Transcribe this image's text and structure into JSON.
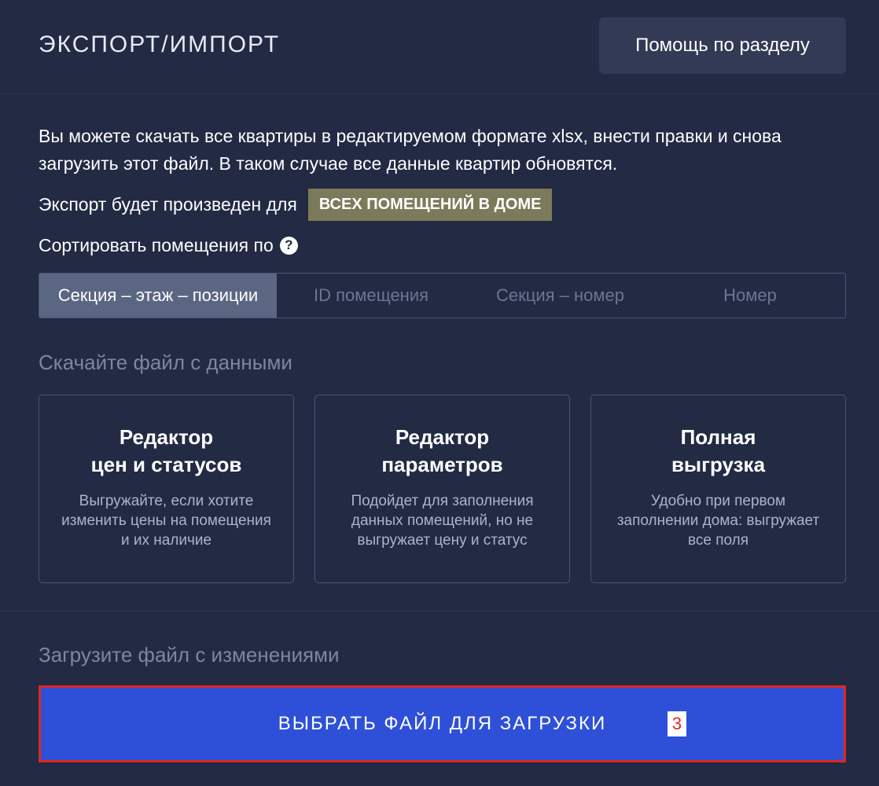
{
  "header": {
    "title": "ЭКСПОРТ/ИМПОРТ",
    "help_button": "Помощь по разделу"
  },
  "intro": {
    "text": "Вы можете скачать все квартиры в редактируемом формате xlsx, внести правки и снова загрузить этот файл. В таком случае все данные квартир обновятся."
  },
  "export_scope": {
    "label": "Экспорт будет произведен для",
    "value": "ВСЕХ ПОМЕЩЕНИЙ В ДОМЕ",
    "color": "#7b7a5a"
  },
  "sort": {
    "label": "Сортировать помещения по",
    "help_icon": "question-circle-icon",
    "help_glyph": "?",
    "options": [
      {
        "label": "Секция – этаж – позиции",
        "selected": true
      },
      {
        "label": "ID помещения",
        "selected": false
      },
      {
        "label": "Секция – номер",
        "selected": false
      },
      {
        "label": "Номер",
        "selected": false
      }
    ]
  },
  "download": {
    "title": "Скачайте файл с данными",
    "cards": [
      {
        "title_line1": "Редактор",
        "title_line2": "цен и статусов",
        "description": "Выгружайте, если хотите изменить цены на помещения и их наличие"
      },
      {
        "title_line1": "Редактор",
        "title_line2": "параметров",
        "description": "Подойдет для заполнения данных помещений, но не выгружает цену и статус"
      },
      {
        "title_line1": "Полная",
        "title_line2": "выгрузка",
        "description": "Удобно при первом заполнении дома: выгружает все поля"
      }
    ]
  },
  "upload": {
    "title": "Загрузите файл с изменениями",
    "button": "ВЫБРАТЬ ФАЙЛ ДЛЯ ЗАГРУЗКИ",
    "button_color": "#2e50d8",
    "highlight_color": "#e0271f",
    "marker": "3"
  }
}
